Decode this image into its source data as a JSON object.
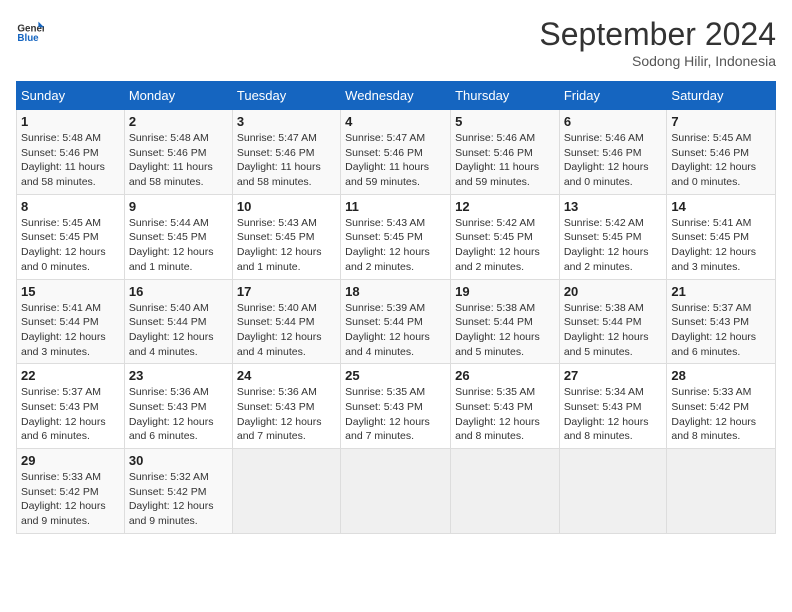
{
  "header": {
    "logo_line1": "General",
    "logo_line2": "Blue",
    "month": "September 2024",
    "location": "Sodong Hilir, Indonesia"
  },
  "days_of_week": [
    "Sunday",
    "Monday",
    "Tuesday",
    "Wednesday",
    "Thursday",
    "Friday",
    "Saturday"
  ],
  "weeks": [
    [
      {
        "day": "1",
        "info": "Sunrise: 5:48 AM\nSunset: 5:46 PM\nDaylight: 11 hours\nand 58 minutes."
      },
      {
        "day": "2",
        "info": "Sunrise: 5:48 AM\nSunset: 5:46 PM\nDaylight: 11 hours\nand 58 minutes."
      },
      {
        "day": "3",
        "info": "Sunrise: 5:47 AM\nSunset: 5:46 PM\nDaylight: 11 hours\nand 58 minutes."
      },
      {
        "day": "4",
        "info": "Sunrise: 5:47 AM\nSunset: 5:46 PM\nDaylight: 11 hours\nand 59 minutes."
      },
      {
        "day": "5",
        "info": "Sunrise: 5:46 AM\nSunset: 5:46 PM\nDaylight: 11 hours\nand 59 minutes."
      },
      {
        "day": "6",
        "info": "Sunrise: 5:46 AM\nSunset: 5:46 PM\nDaylight: 12 hours\nand 0 minutes."
      },
      {
        "day": "7",
        "info": "Sunrise: 5:45 AM\nSunset: 5:46 PM\nDaylight: 12 hours\nand 0 minutes."
      }
    ],
    [
      {
        "day": "8",
        "info": "Sunrise: 5:45 AM\nSunset: 5:45 PM\nDaylight: 12 hours\nand 0 minutes."
      },
      {
        "day": "9",
        "info": "Sunrise: 5:44 AM\nSunset: 5:45 PM\nDaylight: 12 hours\nand 1 minute."
      },
      {
        "day": "10",
        "info": "Sunrise: 5:43 AM\nSunset: 5:45 PM\nDaylight: 12 hours\nand 1 minute."
      },
      {
        "day": "11",
        "info": "Sunrise: 5:43 AM\nSunset: 5:45 PM\nDaylight: 12 hours\nand 2 minutes."
      },
      {
        "day": "12",
        "info": "Sunrise: 5:42 AM\nSunset: 5:45 PM\nDaylight: 12 hours\nand 2 minutes."
      },
      {
        "day": "13",
        "info": "Sunrise: 5:42 AM\nSunset: 5:45 PM\nDaylight: 12 hours\nand 2 minutes."
      },
      {
        "day": "14",
        "info": "Sunrise: 5:41 AM\nSunset: 5:45 PM\nDaylight: 12 hours\nand 3 minutes."
      }
    ],
    [
      {
        "day": "15",
        "info": "Sunrise: 5:41 AM\nSunset: 5:44 PM\nDaylight: 12 hours\nand 3 minutes."
      },
      {
        "day": "16",
        "info": "Sunrise: 5:40 AM\nSunset: 5:44 PM\nDaylight: 12 hours\nand 4 minutes."
      },
      {
        "day": "17",
        "info": "Sunrise: 5:40 AM\nSunset: 5:44 PM\nDaylight: 12 hours\nand 4 minutes."
      },
      {
        "day": "18",
        "info": "Sunrise: 5:39 AM\nSunset: 5:44 PM\nDaylight: 12 hours\nand 4 minutes."
      },
      {
        "day": "19",
        "info": "Sunrise: 5:38 AM\nSunset: 5:44 PM\nDaylight: 12 hours\nand 5 minutes."
      },
      {
        "day": "20",
        "info": "Sunrise: 5:38 AM\nSunset: 5:44 PM\nDaylight: 12 hours\nand 5 minutes."
      },
      {
        "day": "21",
        "info": "Sunrise: 5:37 AM\nSunset: 5:43 PM\nDaylight: 12 hours\nand 6 minutes."
      }
    ],
    [
      {
        "day": "22",
        "info": "Sunrise: 5:37 AM\nSunset: 5:43 PM\nDaylight: 12 hours\nand 6 minutes."
      },
      {
        "day": "23",
        "info": "Sunrise: 5:36 AM\nSunset: 5:43 PM\nDaylight: 12 hours\nand 6 minutes."
      },
      {
        "day": "24",
        "info": "Sunrise: 5:36 AM\nSunset: 5:43 PM\nDaylight: 12 hours\nand 7 minutes."
      },
      {
        "day": "25",
        "info": "Sunrise: 5:35 AM\nSunset: 5:43 PM\nDaylight: 12 hours\nand 7 minutes."
      },
      {
        "day": "26",
        "info": "Sunrise: 5:35 AM\nSunset: 5:43 PM\nDaylight: 12 hours\nand 8 minutes."
      },
      {
        "day": "27",
        "info": "Sunrise: 5:34 AM\nSunset: 5:43 PM\nDaylight: 12 hours\nand 8 minutes."
      },
      {
        "day": "28",
        "info": "Sunrise: 5:33 AM\nSunset: 5:42 PM\nDaylight: 12 hours\nand 8 minutes."
      }
    ],
    [
      {
        "day": "29",
        "info": "Sunrise: 5:33 AM\nSunset: 5:42 PM\nDaylight: 12 hours\nand 9 minutes."
      },
      {
        "day": "30",
        "info": "Sunrise: 5:32 AM\nSunset: 5:42 PM\nDaylight: 12 hours\nand 9 minutes."
      },
      {
        "day": "",
        "info": ""
      },
      {
        "day": "",
        "info": ""
      },
      {
        "day": "",
        "info": ""
      },
      {
        "day": "",
        "info": ""
      },
      {
        "day": "",
        "info": ""
      }
    ]
  ]
}
